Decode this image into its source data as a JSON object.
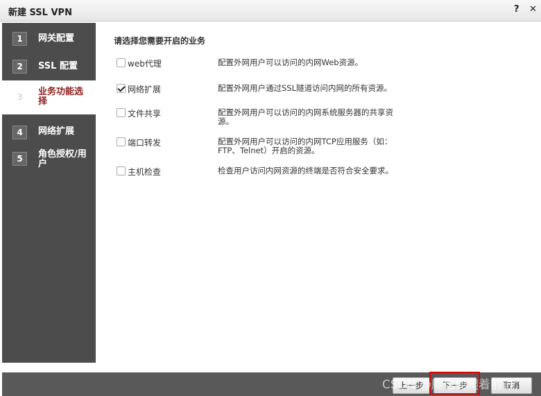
{
  "window": {
    "title": "新建 SSL VPN",
    "help_glyph": "?",
    "close_glyph": "✕"
  },
  "sidebar": {
    "steps": [
      {
        "num": "1",
        "label": "网关配置",
        "active": false
      },
      {
        "num": "2",
        "label": "SSL 配置",
        "active": false
      },
      {
        "num": "3",
        "label": "业务功能选择",
        "active": true
      },
      {
        "num": "4",
        "label": "网络扩展",
        "active": false
      },
      {
        "num": "5",
        "label": "角色授权/用户",
        "active": false
      }
    ]
  },
  "main": {
    "section_title": "请选择您需要开启的业务",
    "options": [
      {
        "label": "web代理",
        "checked": false,
        "desc": "配置外网用户可以访问的内网Web资源。"
      },
      {
        "label": "网络扩展",
        "checked": true,
        "desc": "配置外网用户通过SSL隧道访问内网的所有资源。"
      },
      {
        "label": "文件共享",
        "checked": false,
        "desc": "配置外网用户可以访问的内网系统服务器的共享资源。"
      },
      {
        "label": "端口转发",
        "checked": false,
        "desc": "配置外网用户可以访问的内网TCP应用服务（如：FTP、Telnet）开启的资源。"
      },
      {
        "label": "主机检查",
        "checked": false,
        "desc": "检查用户访问内网资源的终端是否符合安全要求。"
      }
    ]
  },
  "footer": {
    "prev_label": "上一步",
    "next_label": "下一步",
    "cancel_label": "取消"
  },
  "watermark": "CSDN @爬也要爬着前进",
  "colors": {
    "sidebar_bg": "#4c4c4c",
    "active_step_text": "#8b2020",
    "footer_bg": "#595959",
    "highlight": "#e00000"
  }
}
